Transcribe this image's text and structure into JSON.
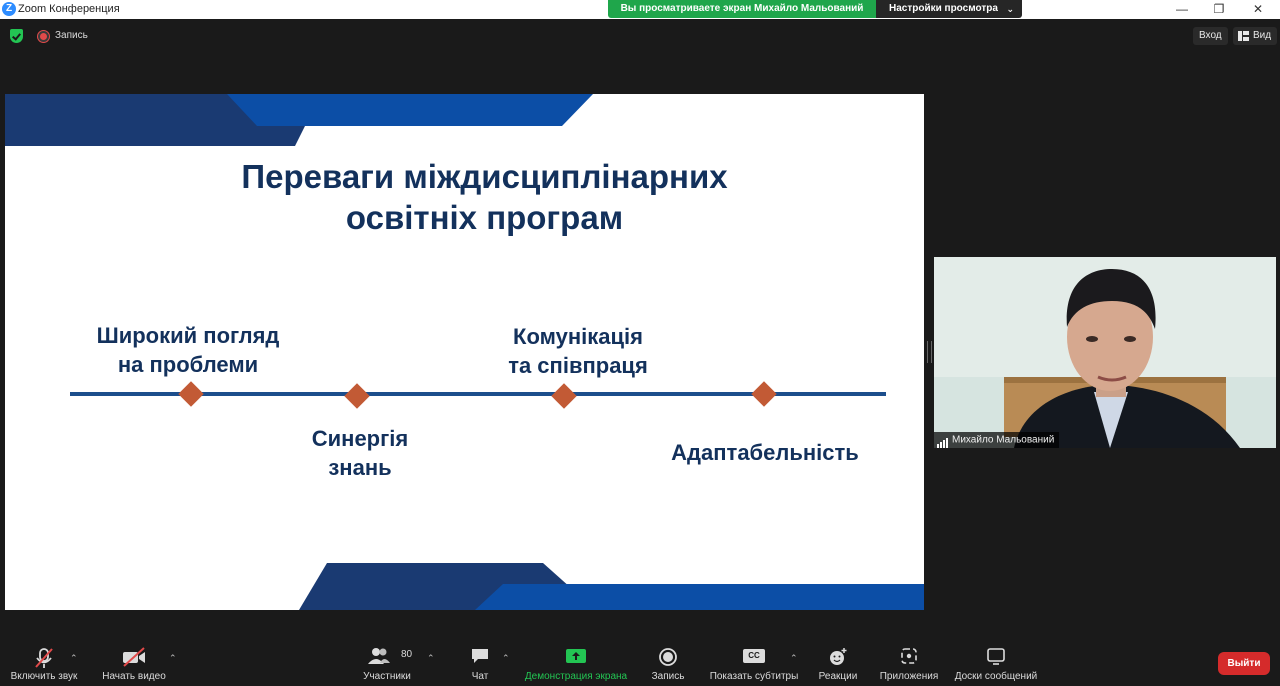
{
  "window": {
    "title": "Zoom Конференция",
    "logo": "Z",
    "controls": [
      "—",
      "❐",
      "✕"
    ]
  },
  "share_banner": {
    "text": "Вы просматриваете экран Михайло Мальований",
    "settings_label": "Настройки просмотра",
    "settings_chevron": "⌄"
  },
  "topbar": {
    "recording_label": "Запись",
    "login_label": "Вход",
    "view_label": "Вид"
  },
  "slide": {
    "title_line1": "Переваги міждисциплінарних",
    "title_line2": "освітніх програм",
    "labels": {
      "a_line1": "Широкий погляд",
      "a_line2": "на проблеми",
      "b_line1": "Синергія",
      "b_line2": "знань",
      "c_line1": "Комунікація",
      "c_line2": "та співпраця",
      "d": "Адаптабельність"
    },
    "colors": {
      "navy": "#13315c",
      "blue": "#1c4e8c",
      "accent": "#c25a35"
    }
  },
  "video": {
    "participant_name": "Михайло Мальований"
  },
  "toolbar": {
    "items": [
      {
        "label": "Включить звук",
        "icon": "mic-muted-icon"
      },
      {
        "label": "Начать видео",
        "icon": "video-off-icon"
      },
      {
        "label": "Участники",
        "icon": "participants-icon",
        "count": "80"
      },
      {
        "label": "Чат",
        "icon": "chat-icon"
      },
      {
        "label": "Демонстрация экрана",
        "icon": "share-screen-icon"
      },
      {
        "label": "Запись",
        "icon": "record-icon"
      },
      {
        "label": "Показать субтитры",
        "icon": "cc-icon",
        "badge": "CC"
      },
      {
        "label": "Реакции",
        "icon": "reactions-icon"
      },
      {
        "label": "Приложения",
        "icon": "apps-icon"
      },
      {
        "label": "Доски сообщений",
        "icon": "whiteboard-icon"
      }
    ],
    "leave_label": "Выйти"
  }
}
